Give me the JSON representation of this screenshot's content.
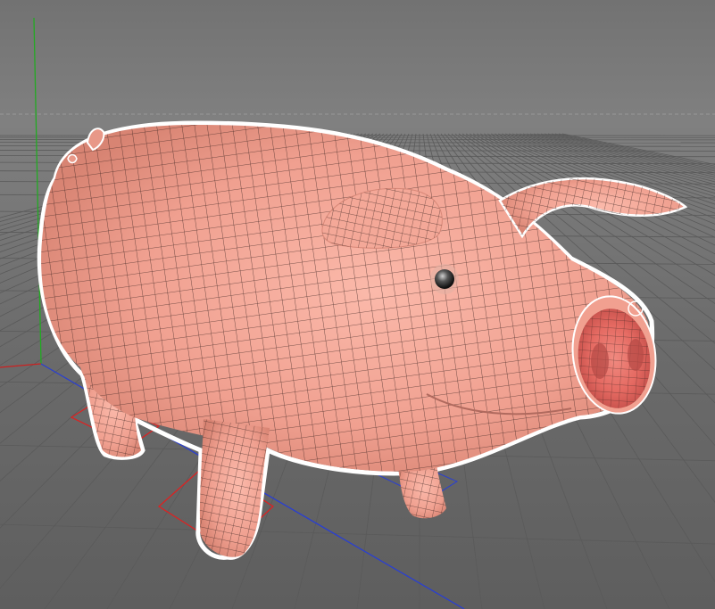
{
  "viewport": {
    "background_color": "#777777",
    "floor_grid_color": "#5a5a5a",
    "horizon_dash_color": "#9a9a9a"
  },
  "axes": {
    "x_axis_color": "#cc2020",
    "y_axis_color": "#22aa22",
    "z_axis_color": "#2a3fd0"
  },
  "model": {
    "name_icon": "pig-mesh",
    "skin_color": "#f3a494",
    "shadow_color": "#d98270",
    "snout_inner_color": "#e46a63",
    "wire_color": "#2a1a18",
    "selection_outline_color": "#ffffff",
    "leg_selection_color": "#e02020"
  }
}
